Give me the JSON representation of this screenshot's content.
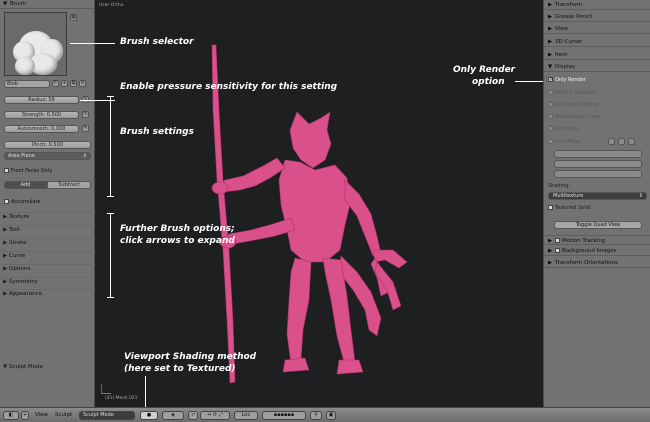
{
  "left_panel": {
    "header": "Brush",
    "brush_name": "Blob",
    "brush_users": "F",
    "radius": "Radius: 58",
    "strength": "Strength: 0.500",
    "autosmooth": "Autosmooth: 0.000",
    "pinch": "Pinch: 0.500",
    "area_plane": "Area Plane",
    "front_faces_only": "Front Faces Only",
    "add": "Add",
    "subtract": "Subtract",
    "accumulate": "Accumulate",
    "sections": [
      "Texture",
      "Tool",
      "Stroke",
      "Curve",
      "Options",
      "Symmetry",
      "Appearance"
    ],
    "sculpt_mode": "Sculpt Mode"
  },
  "viewport": {
    "label": "User Ortho",
    "status": "(41) Mesh.021"
  },
  "annotations": {
    "brush_selector": "Brush selector",
    "pressure": "Enable pressure sensitivity for this setting",
    "brush_settings": "Brush settings",
    "further_1": "Further Brush options;",
    "further_2": "click arrows to expand",
    "shading_1": "Viewport Shading method",
    "shading_2": "(here set to Textured)",
    "only_render_1": "Only Render",
    "only_render_2": "option"
  },
  "right_panel": {
    "sections_top": [
      "Transform",
      "Grease Pencil",
      "View",
      "3D Cursor",
      "Item",
      "Display"
    ],
    "display_options": [
      "Only Render",
      "Outline Selected",
      "All Object Origins",
      "Relationship Lines",
      "All Edges"
    ],
    "grid_floor": "Grid Floor",
    "shading_label": "Shading:",
    "shading_value": "Multitexture",
    "textured_solid": "Textured Solid",
    "toggle_quad_view": "Toggle Quad View",
    "sections_bottom": [
      "Motion Tracking",
      "Background Images",
      "Transform Orientations"
    ]
  },
  "bottom_bar": {
    "view": "View",
    "sculpt": "Sculpt",
    "mode": "Sculpt Mode",
    "pivot": "Loc"
  },
  "colors": {
    "panel": "#727272",
    "viewport": "#1d1f20",
    "model": "#d9508a",
    "annotation": "#ffffff"
  }
}
